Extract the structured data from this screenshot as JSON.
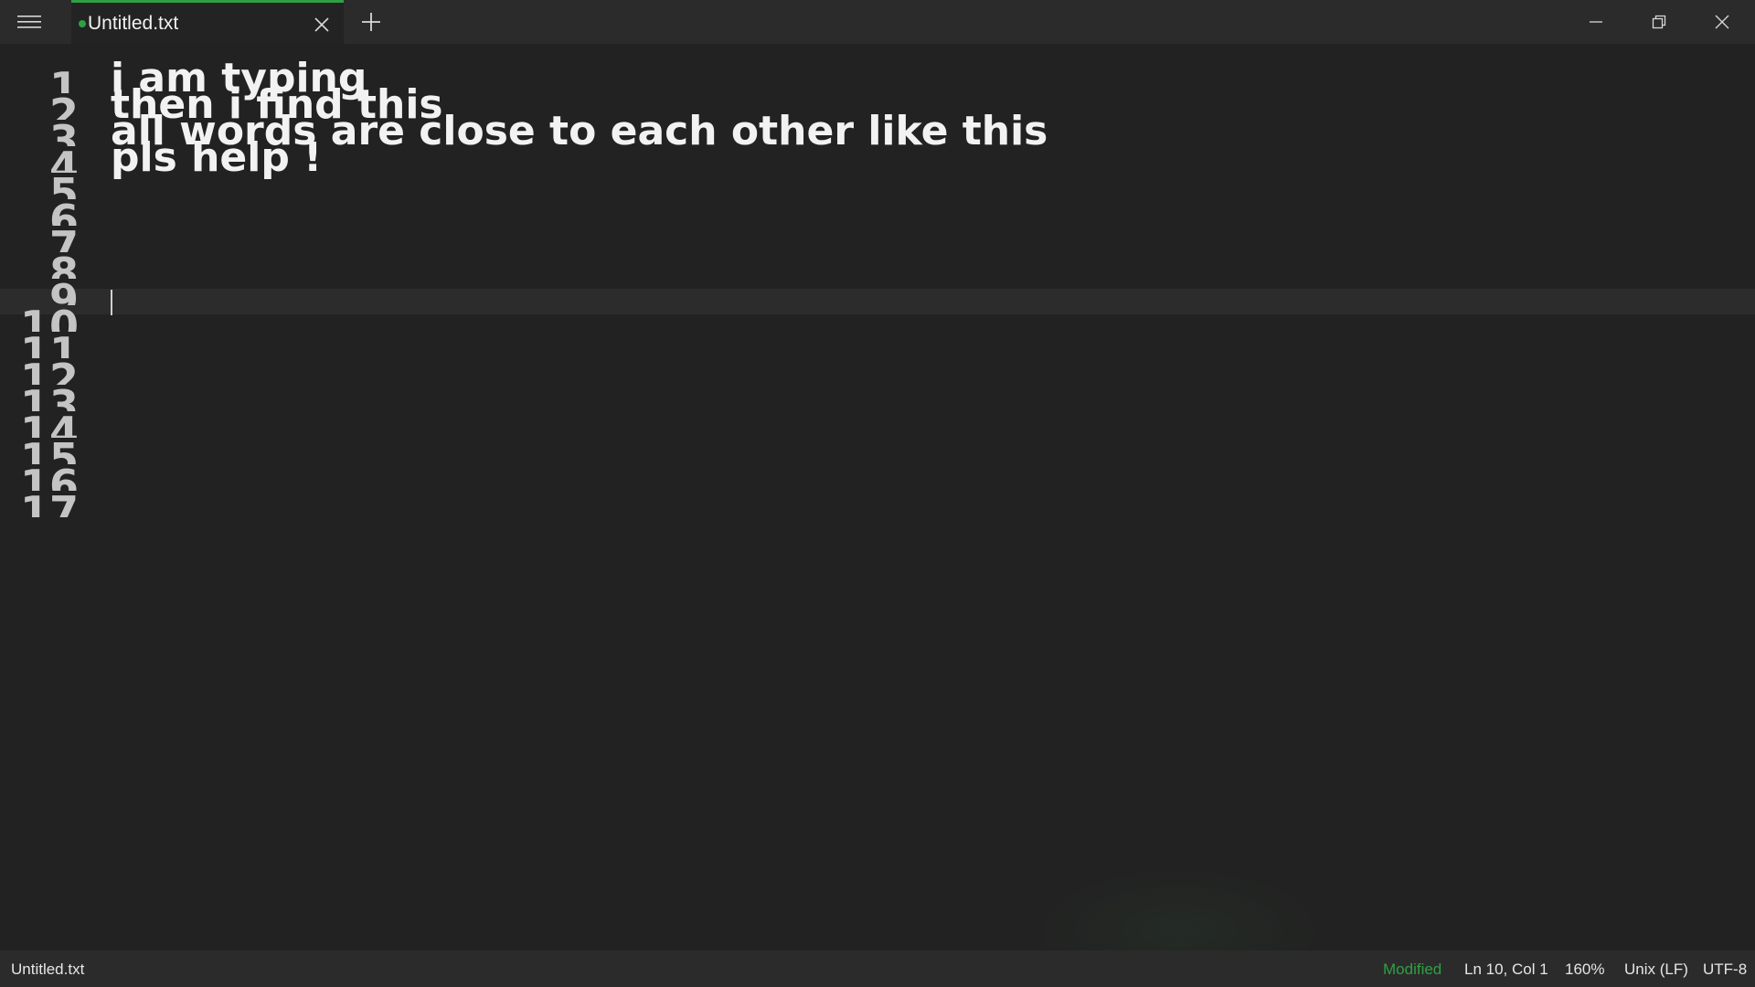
{
  "app": {
    "accent_color": "#2ea043"
  },
  "titlebar": {
    "menu_icon": "hamburger-menu-icon",
    "tab": {
      "title": "Untitled.txt",
      "modified_dot": "modified-dot-icon",
      "close_icon": "close-icon"
    },
    "new_tab_icon": "plus-icon",
    "window_controls": [
      "minimize-icon",
      "restore-icon",
      "close-icon"
    ]
  },
  "editor": {
    "line_numbers": [
      "1",
      "2",
      "3",
      "4",
      "5",
      "6",
      "7",
      "8",
      "9",
      "10",
      "11",
      "12",
      "13",
      "14",
      "15",
      "16",
      "17"
    ],
    "lines": [
      "i am typing",
      "then i find this",
      "all words are close to each other like this",
      "pls help !"
    ],
    "active_line": 10
  },
  "statusbar": {
    "file_name": "Untitled.txt",
    "modified": "Modified",
    "position": "Ln 10, Col 1",
    "zoom": "160%",
    "line_ending": "Unix (LF)",
    "encoding": "UTF-8"
  }
}
